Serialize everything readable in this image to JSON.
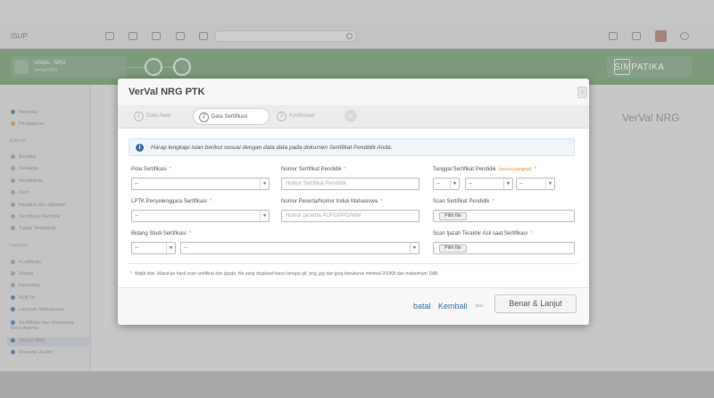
{
  "background": {
    "brand": "ISUP",
    "logo_title": "NRGA · NRG",
    "logo_subtitle": "Verval NRG",
    "app_name": "SIMPATIKA",
    "right_title": "VerVal NRG",
    "sidebar": {
      "top_items": [
        "Beranda",
        "Pengaturan"
      ],
      "section1": "Aplikasi",
      "items1": [
        "Biodata",
        "Keluarga",
        "Pendidikan",
        "Karir",
        "Pangkat dan Jabatan",
        "Sertifikasi Pendidik",
        "Tugas Tambahan"
      ],
      "section2": "Layanan",
      "items2": [
        "Kualifikasi",
        "Mutasi",
        "Inpassing",
        "NUPTK",
        "Layanan Mahasiswa",
        "Sertifikasi dan Impassing Guru Agama",
        "VerVal NRG",
        "Riwayat Usulan"
      ]
    }
  },
  "modal": {
    "title": "VerVal NRG PTK",
    "close": "›",
    "wizard": [
      {
        "num": "1",
        "label": "Data Awal"
      },
      {
        "num": "2",
        "label": "Data Sertifikasi"
      },
      {
        "num": "3",
        "label": "Konfirmasi"
      }
    ],
    "info": "Harap lengkapi isian berikut sesuai dengan data data pada dokumen Sertifikat Pendidik Anda.",
    "fields": {
      "pola_label": "Pola Sertifikasi",
      "pola_value": "--",
      "nomor_label": "Nomor Sertifikat Pendidik",
      "nomor_placeholder": "Nomor Sertifikat Pendidik",
      "tanggal_label": "Tanggal Sertifikat Pendidik",
      "tanggal_hint": "(sesuai pangkat)",
      "tgl_value": "--",
      "bln_value": "--",
      "thn_value": "--",
      "lptk_label": "LPTK Penyelenggara Sertifikasi",
      "lptk_value": "--",
      "nim_label": "Nomor Peserta/Nomor Induk Mahasiswa",
      "nim_placeholder": "Nomor peserta PLPG/PPG/NIM",
      "scan_label": "Scan Sertifikat Pendidik",
      "bidang_label": "Bidang Studi Sertifikasi",
      "bidang_code": "--",
      "bidang_value": "--",
      "ijazah_label": "Scan Ijazah Terakhir Asli saat Sertifikasi",
      "file_btn": "Pilih file"
    },
    "note": "Wajib diisi. Masukan hasil scan sertifikat dan ijazah, file yang diupload harus berupa gif, png, jpg dan jpeg berukuran minimal 200KB dan maksimum 1MB.",
    "footer": {
      "batal": "batal",
      "kembali": "Kembali",
      "atau": "atau",
      "next": "Benar & Lanjut"
    }
  }
}
